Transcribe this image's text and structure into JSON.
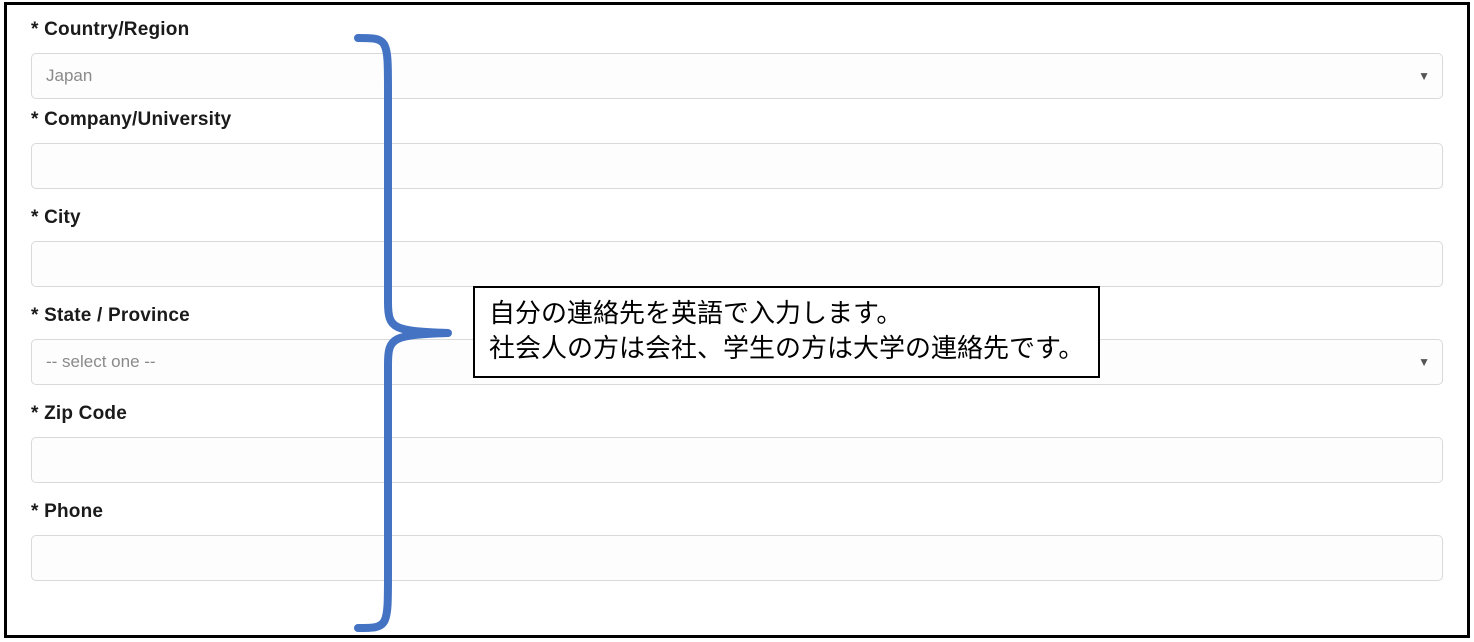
{
  "form": {
    "asterisk": "*",
    "country": {
      "label": "Country/Region",
      "value": "Japan"
    },
    "company": {
      "label": "Company/University",
      "value": ""
    },
    "city": {
      "label": "City",
      "value": ""
    },
    "state": {
      "label": "State / Province",
      "value": "-- select one --"
    },
    "zip": {
      "label": "Zip Code",
      "value": ""
    },
    "phone": {
      "label": "Phone",
      "value": ""
    }
  },
  "annotation": {
    "line1": "自分の連絡先を英語で入力します。",
    "line2": "社会人の方は会社、学生の方は大学の連絡先です。",
    "brace_color": "#4573C4"
  }
}
